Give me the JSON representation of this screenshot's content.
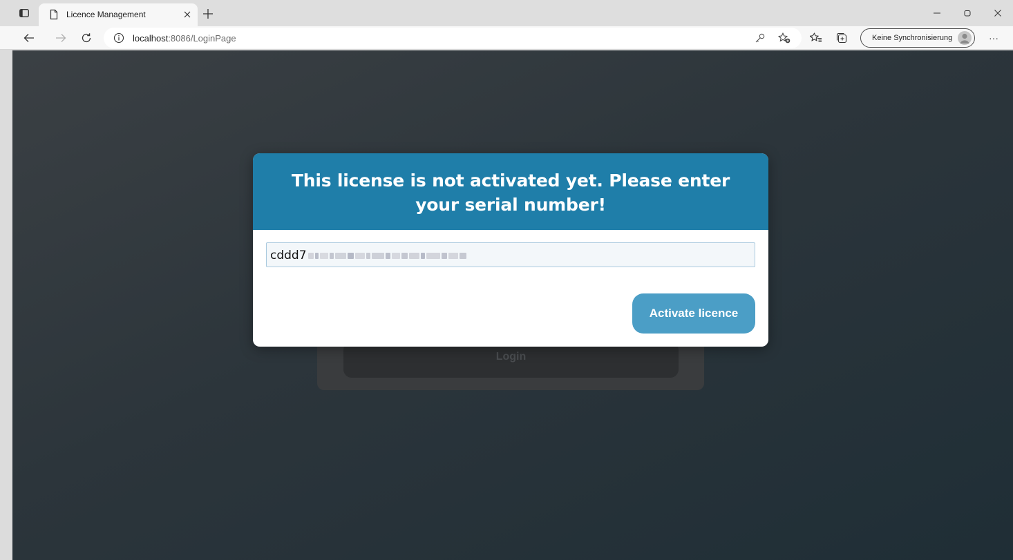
{
  "browser": {
    "tab_title": "Licence Management",
    "url_host": "localhost",
    "url_path": ":8086/LoginPage",
    "profile_label": "Keine Synchronisierung",
    "more_label": "···",
    "accent_color": "#1f7ea9"
  },
  "page": {
    "login_label": "Login",
    "modal": {
      "title": "This license is not activated yet. Please enter your serial number!",
      "serial_value": "cddd7",
      "activate_label": "Activate licence",
      "header_color": "#1f7ea9",
      "button_color": "#4b9ec6"
    }
  }
}
